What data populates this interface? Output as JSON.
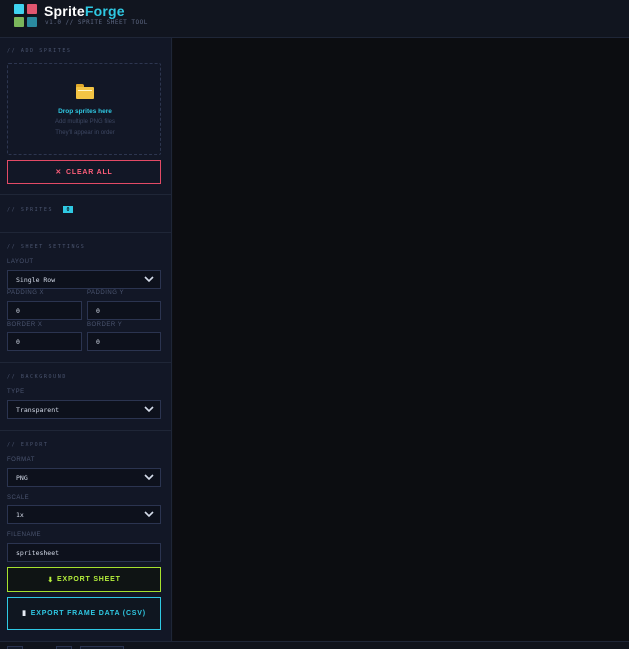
{
  "app": {
    "name_part1": "Sprite",
    "name_part2": "Forge",
    "tagline": "v1.0 // SPRITE SHEET TOOL",
    "logo_colors": [
      "#3fd3f0",
      "#e0566f",
      "#7bb65b",
      "#2a8a9f"
    ]
  },
  "add_sprites": {
    "title": "// ADD SPRITES",
    "drop_title": "Drop sprites here",
    "drop_sub1": "Add multiple PNG files",
    "drop_sub2": "They'll appear in order",
    "folder_icon": "folder-icon",
    "clear_button": "CLEAR ALL",
    "clear_icon": "✕"
  },
  "sprites": {
    "title": "// SPRITES",
    "count": "0"
  },
  "sheet_settings": {
    "title": "// SHEET SETTINGS",
    "layout_label": "LAYOUT",
    "layout_value": "Single Row",
    "padding_x_label": "PADDING X",
    "padding_x_value": "0",
    "padding_y_label": "PADDING Y",
    "padding_y_value": "0",
    "border_x_label": "BORDER X",
    "border_x_value": "0",
    "border_y_label": "BORDER Y",
    "border_y_value": "0"
  },
  "background": {
    "title": "// BACKGROUND",
    "type_label": "TYPE",
    "type_value": "Transparent"
  },
  "export": {
    "title": "// EXPORT",
    "format_label": "FORMAT",
    "format_value": "PNG",
    "scale_label": "SCALE",
    "scale_value": "1x",
    "filename_label": "FILENAME",
    "filename_value": "spritesheet",
    "export_button": "EXPORT SHEET",
    "export_icon": "⬇",
    "frame_data_button": "EXPORT FRAME DATA (CSV)",
    "frame_data_icon": "▮"
  },
  "colors": {
    "accent_cyan": "#2fc9e3",
    "accent_red": "#e34a66",
    "accent_green": "#a6e22e"
  }
}
